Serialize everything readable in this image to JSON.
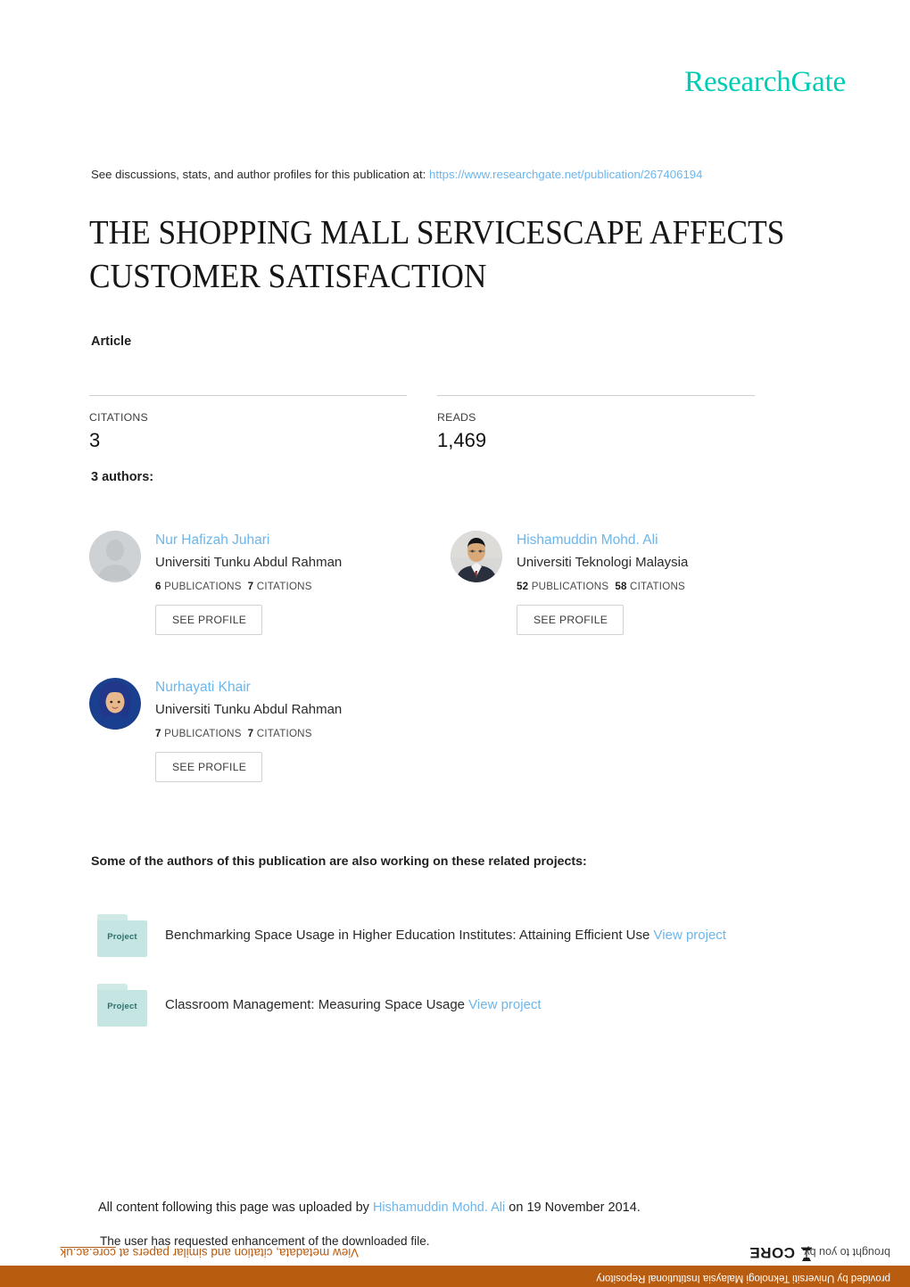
{
  "brand": {
    "logo_text": "ResearchGate",
    "logo_color": "#00ccb4"
  },
  "discussions": {
    "prefix": "See discussions, stats, and author profiles for this publication at:",
    "url": "https://www.researchgate.net/publication/267406194",
    "url_color": "#6cb6ec"
  },
  "publication": {
    "title": "THE SHOPPING MALL SERVICESCAPE AFFECTS CUSTOMER SATISFACTION",
    "type": "Article"
  },
  "metrics": [
    {
      "label": "CITATIONS",
      "value": "3"
    },
    {
      "label": "READS",
      "value": "1,469"
    }
  ],
  "authors_section": {
    "heading": "3 authors:",
    "see_profile_label": "SEE PROFILE",
    "publications_label": "PUBLICATIONS",
    "citations_label": "CITATIONS"
  },
  "authors": [
    {
      "name": "Nur Hafizah Juhari",
      "affiliation": "Universiti Tunku Abdul Rahman",
      "publications": "6",
      "citations": "7",
      "avatar": "placeholder-avatar-icon",
      "button": "SEE PROFILE"
    },
    {
      "name": "Hishamuddin Mohd. Ali",
      "affiliation": "Universiti Teknologi Malaysia",
      "publications": "52",
      "citations": "58",
      "avatar": "photo-avatar-man",
      "button": "SEE PROFILE"
    },
    {
      "name": "Nurhayati Khair",
      "affiliation": "Universiti Tunku Abdul Rahman",
      "publications": "7",
      "citations": "7",
      "avatar": "photo-avatar-woman",
      "button": "SEE PROFILE"
    }
  ],
  "projects_section": {
    "heading": "Some of the authors of this publication are also working on these related projects:",
    "folder_label": "Project",
    "view_label": "View project"
  },
  "projects": [
    {
      "title": "Benchmarking Space Usage in Higher Education Institutes: Attaining Efficient Use",
      "view": "View project"
    },
    {
      "title": "Classroom Management: Measuring Space Usage",
      "view": "View project"
    }
  ],
  "footer": {
    "upload_prefix": "All content following this page was uploaded by",
    "upload_author": "Hishamuddin Mohd. Ali",
    "upload_suffix": "on 19 November 2014.",
    "enhance_note": "The user has requested enhancement of the downloaded file."
  },
  "core_banner": {
    "bar_text": "provided by Universiti Teknologi Malaysia Institutional Repository",
    "metadata_prefix": "View metadata, citation and similar papers at",
    "metadata_link": "core.ac.uk",
    "brought_text": "brought to you by",
    "logo_text": "CORE",
    "bar_color": "#b85c10"
  }
}
